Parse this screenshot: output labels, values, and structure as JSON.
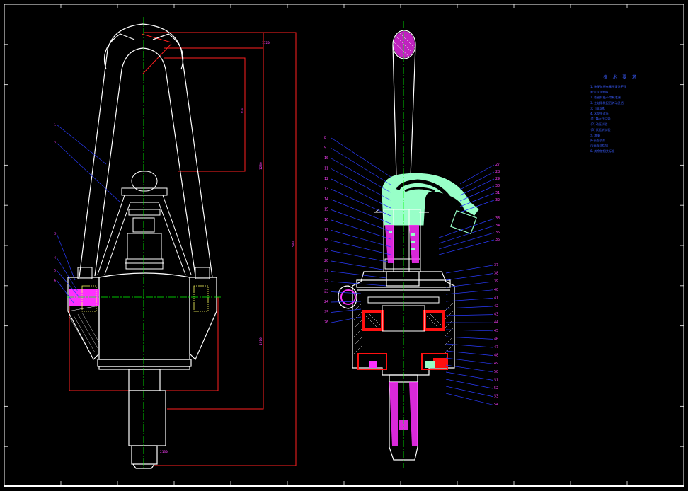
{
  "colors": {
    "background": "#000000",
    "outline": "#ffffff",
    "centerline": "#00ff00",
    "dimension": "#ff2020",
    "leader": "#2a3cff",
    "label": "#ff40ff",
    "gooseneck": "#98ffc8",
    "hatch_red": "#ff1010",
    "hatch_magenta": "#ff30ff"
  },
  "notes": {
    "title": "技 术 要 求",
    "lines": [
      "1.装配前所有零件清洗干净",
      "  并涂以润滑脂",
      "2.各密封处不得有泄漏",
      "3.主轴承装配后转动灵活",
      "  无卡阻现象",
      "4.水龙头试压",
      "  (1)静水压试验",
      "  (2)动压试验",
      "  (3)试运转试验",
      "5.油漆",
      "  外表面喷漆",
      "  内表面涂防锈",
      "6.其余按相关标准"
    ]
  },
  "left_view": {
    "labels": [
      "1",
      "2",
      "3",
      "4",
      "5",
      "6"
    ],
    "dims": [
      "1580",
      "1280",
      "830",
      "1720",
      "1910",
      "2130"
    ]
  },
  "right_view": {
    "labels_left": [
      "8",
      "9",
      "10",
      "11",
      "12",
      "13",
      "14",
      "15",
      "16",
      "17",
      "18",
      "19",
      "20",
      "21",
      "22",
      "23",
      "24",
      "25",
      "26"
    ],
    "labels_right": [
      "27",
      "28",
      "29",
      "30",
      "31",
      "32",
      "33",
      "34",
      "35",
      "36",
      "37",
      "38",
      "39",
      "40",
      "41",
      "42",
      "43",
      "44",
      "45",
      "46",
      "47",
      "48",
      "49",
      "50",
      "51",
      "52",
      "53",
      "54"
    ]
  },
  "frame": {
    "border_ticks": 12
  }
}
